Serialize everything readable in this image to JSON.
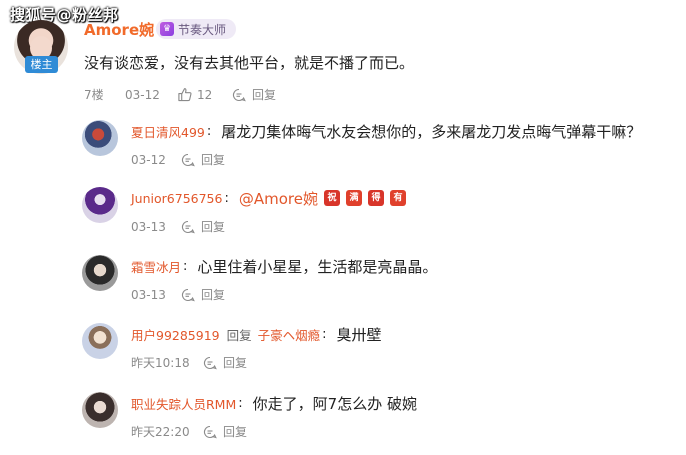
{
  "watermark": "搜狐号@粉丝邦",
  "main": {
    "name": "Amore婉",
    "level_badge": "节奏大师",
    "host_badge": "楼主",
    "text": "没有谈恋爱，没有去其他平台，就是不播了而已。",
    "floor": "7楼",
    "date": "03-12",
    "likes": "12",
    "reply_label": "回复"
  },
  "replies": [
    {
      "name": "夏日清风499",
      "text": "屠龙刀集体晦气水友会想你的，多来屠龙刀发点晦气弹幕干嘛？",
      "date": "03-12",
      "reply_label": "回复"
    },
    {
      "name": "Junior6756756",
      "mention": "@Amore婉",
      "emojis": [
        "祝",
        "满",
        "得",
        "有"
      ],
      "date": "03-13",
      "reply_label": "回复"
    },
    {
      "name": "霜雪冰月",
      "text": "心里住着小星星，生活都是亮晶晶。",
      "date": "03-13",
      "reply_label": "回复"
    },
    {
      "name": "用户99285919",
      "reply_to_label": "回复",
      "reply_to_name": "子豪ヘ烟瘾",
      "text": "臭卅壁",
      "date": "昨天10:18",
      "reply_label": "回复"
    },
    {
      "name": "职业失踪人员RMM",
      "text": "你走了，阿7怎么办 破婉",
      "date": "昨天22:20",
      "reply_label": "回复"
    }
  ],
  "colors": {
    "name_orange": "#f16a2a",
    "host_badge_blue": "#2f8bd6",
    "meta_gray": "#8a8a8a"
  }
}
